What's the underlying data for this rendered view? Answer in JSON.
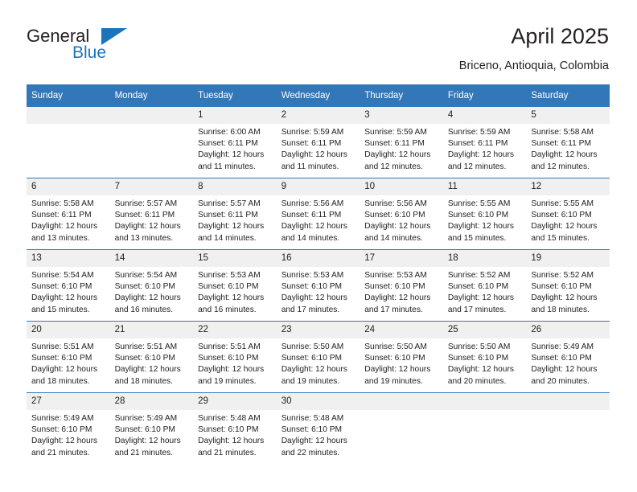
{
  "logo": {
    "word1": "General",
    "word2": "Blue",
    "triangle_color": "#1b75bb"
  },
  "header": {
    "title": "April 2025",
    "subtitle": "Briceno, Antioquia, Colombia"
  },
  "theme": {
    "header_bg": "#3277b8",
    "header_text": "#ffffff",
    "daynum_bg": "#f0f0f0",
    "grid_line": "#3277b8"
  },
  "weekdays": [
    "Sunday",
    "Monday",
    "Tuesday",
    "Wednesday",
    "Thursday",
    "Friday",
    "Saturday"
  ],
  "labels": {
    "sunrise": "Sunrise:",
    "sunset": "Sunset:",
    "daylight": "Daylight:"
  },
  "weeks": [
    [
      {
        "day": "",
        "empty": true
      },
      {
        "day": "",
        "empty": true
      },
      {
        "day": "1",
        "sunrise": "Sunrise: 6:00 AM",
        "sunset": "Sunset: 6:11 PM",
        "daylight": "Daylight: 12 hours and 11 minutes."
      },
      {
        "day": "2",
        "sunrise": "Sunrise: 5:59 AM",
        "sunset": "Sunset: 6:11 PM",
        "daylight": "Daylight: 12 hours and 11 minutes."
      },
      {
        "day": "3",
        "sunrise": "Sunrise: 5:59 AM",
        "sunset": "Sunset: 6:11 PM",
        "daylight": "Daylight: 12 hours and 12 minutes."
      },
      {
        "day": "4",
        "sunrise": "Sunrise: 5:59 AM",
        "sunset": "Sunset: 6:11 PM",
        "daylight": "Daylight: 12 hours and 12 minutes."
      },
      {
        "day": "5",
        "sunrise": "Sunrise: 5:58 AM",
        "sunset": "Sunset: 6:11 PM",
        "daylight": "Daylight: 12 hours and 12 minutes."
      }
    ],
    [
      {
        "day": "6",
        "sunrise": "Sunrise: 5:58 AM",
        "sunset": "Sunset: 6:11 PM",
        "daylight": "Daylight: 12 hours and 13 minutes."
      },
      {
        "day": "7",
        "sunrise": "Sunrise: 5:57 AM",
        "sunset": "Sunset: 6:11 PM",
        "daylight": "Daylight: 12 hours and 13 minutes."
      },
      {
        "day": "8",
        "sunrise": "Sunrise: 5:57 AM",
        "sunset": "Sunset: 6:11 PM",
        "daylight": "Daylight: 12 hours and 14 minutes."
      },
      {
        "day": "9",
        "sunrise": "Sunrise: 5:56 AM",
        "sunset": "Sunset: 6:11 PM",
        "daylight": "Daylight: 12 hours and 14 minutes."
      },
      {
        "day": "10",
        "sunrise": "Sunrise: 5:56 AM",
        "sunset": "Sunset: 6:10 PM",
        "daylight": "Daylight: 12 hours and 14 minutes."
      },
      {
        "day": "11",
        "sunrise": "Sunrise: 5:55 AM",
        "sunset": "Sunset: 6:10 PM",
        "daylight": "Daylight: 12 hours and 15 minutes."
      },
      {
        "day": "12",
        "sunrise": "Sunrise: 5:55 AM",
        "sunset": "Sunset: 6:10 PM",
        "daylight": "Daylight: 12 hours and 15 minutes."
      }
    ],
    [
      {
        "day": "13",
        "sunrise": "Sunrise: 5:54 AM",
        "sunset": "Sunset: 6:10 PM",
        "daylight": "Daylight: 12 hours and 15 minutes."
      },
      {
        "day": "14",
        "sunrise": "Sunrise: 5:54 AM",
        "sunset": "Sunset: 6:10 PM",
        "daylight": "Daylight: 12 hours and 16 minutes."
      },
      {
        "day": "15",
        "sunrise": "Sunrise: 5:53 AM",
        "sunset": "Sunset: 6:10 PM",
        "daylight": "Daylight: 12 hours and 16 minutes."
      },
      {
        "day": "16",
        "sunrise": "Sunrise: 5:53 AM",
        "sunset": "Sunset: 6:10 PM",
        "daylight": "Daylight: 12 hours and 17 minutes."
      },
      {
        "day": "17",
        "sunrise": "Sunrise: 5:53 AM",
        "sunset": "Sunset: 6:10 PM",
        "daylight": "Daylight: 12 hours and 17 minutes."
      },
      {
        "day": "18",
        "sunrise": "Sunrise: 5:52 AM",
        "sunset": "Sunset: 6:10 PM",
        "daylight": "Daylight: 12 hours and 17 minutes."
      },
      {
        "day": "19",
        "sunrise": "Sunrise: 5:52 AM",
        "sunset": "Sunset: 6:10 PM",
        "daylight": "Daylight: 12 hours and 18 minutes."
      }
    ],
    [
      {
        "day": "20",
        "sunrise": "Sunrise: 5:51 AM",
        "sunset": "Sunset: 6:10 PM",
        "daylight": "Daylight: 12 hours and 18 minutes."
      },
      {
        "day": "21",
        "sunrise": "Sunrise: 5:51 AM",
        "sunset": "Sunset: 6:10 PM",
        "daylight": "Daylight: 12 hours and 18 minutes."
      },
      {
        "day": "22",
        "sunrise": "Sunrise: 5:51 AM",
        "sunset": "Sunset: 6:10 PM",
        "daylight": "Daylight: 12 hours and 19 minutes."
      },
      {
        "day": "23",
        "sunrise": "Sunrise: 5:50 AM",
        "sunset": "Sunset: 6:10 PM",
        "daylight": "Daylight: 12 hours and 19 minutes."
      },
      {
        "day": "24",
        "sunrise": "Sunrise: 5:50 AM",
        "sunset": "Sunset: 6:10 PM",
        "daylight": "Daylight: 12 hours and 19 minutes."
      },
      {
        "day": "25",
        "sunrise": "Sunrise: 5:50 AM",
        "sunset": "Sunset: 6:10 PM",
        "daylight": "Daylight: 12 hours and 20 minutes."
      },
      {
        "day": "26",
        "sunrise": "Sunrise: 5:49 AM",
        "sunset": "Sunset: 6:10 PM",
        "daylight": "Daylight: 12 hours and 20 minutes."
      }
    ],
    [
      {
        "day": "27",
        "sunrise": "Sunrise: 5:49 AM",
        "sunset": "Sunset: 6:10 PM",
        "daylight": "Daylight: 12 hours and 21 minutes."
      },
      {
        "day": "28",
        "sunrise": "Sunrise: 5:49 AM",
        "sunset": "Sunset: 6:10 PM",
        "daylight": "Daylight: 12 hours and 21 minutes."
      },
      {
        "day": "29",
        "sunrise": "Sunrise: 5:48 AM",
        "sunset": "Sunset: 6:10 PM",
        "daylight": "Daylight: 12 hours and 21 minutes."
      },
      {
        "day": "30",
        "sunrise": "Sunrise: 5:48 AM",
        "sunset": "Sunset: 6:10 PM",
        "daylight": "Daylight: 12 hours and 22 minutes."
      },
      {
        "day": "",
        "empty": true
      },
      {
        "day": "",
        "empty": true
      },
      {
        "day": "",
        "empty": true
      }
    ]
  ]
}
